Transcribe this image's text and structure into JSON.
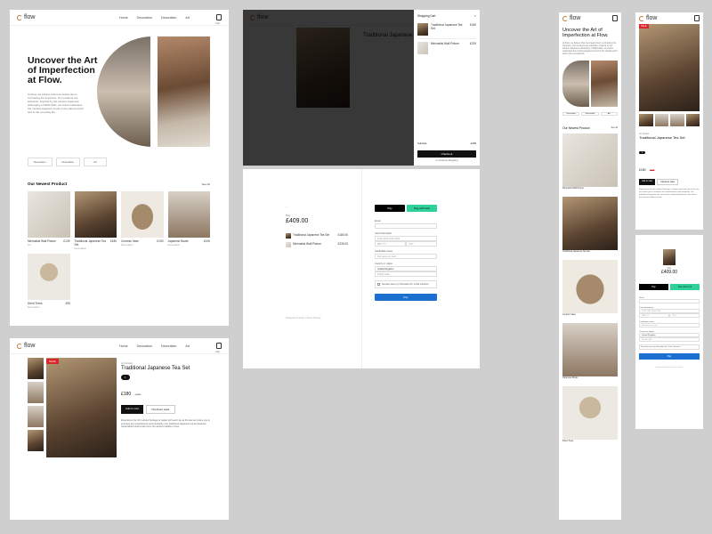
{
  "brand": {
    "name": "flow"
  },
  "nav": {
    "links": [
      "Home",
      "Decoration",
      "Decoration",
      "Art"
    ],
    "cart_label": "Cart"
  },
  "hero": {
    "title": "Uncover the Art of Imperfection at Flow.",
    "body": "At Flow, we believe that true beauty lies in embracing the imperfect. Our products are authentic, inspired by the ancient Japanese philosophy of Wabi-Sabi, our brand celebrates the modest elegance found in the natural world and in the everyday life.",
    "buttons": [
      "Decoration",
      "Decoration",
      "Art"
    ]
  },
  "newest": {
    "heading": "Our Newest Product",
    "see_all": "See All",
    "products": [
      {
        "name": "Minimalist Wall Picture",
        "sub": "Art",
        "price": "£139"
      },
      {
        "name": "Traditional Japanese Tea Set",
        "sub": "Decoration",
        "price": "£180"
      },
      {
        "name": "Ceramic Vase",
        "sub": "Decoration",
        "price": "£190"
      },
      {
        "name": "Japanese Bowls",
        "sub": "Decoration",
        "price": "£190"
      },
      {
        "name": "Dried Trees",
        "sub": "Decoration",
        "price": "£90"
      }
    ]
  },
  "product_page": {
    "badge": "SALE",
    "category": "Art Details",
    "title": "Traditional Japanese Tea Set",
    "qty": "1",
    "price": "£180",
    "old_price": "£250",
    "add_button": "Add to Cart",
    "secondary_button": "Checkout Later",
    "description": "Experience the rich cultural heritage of Japan with each sip as the tea set invites you to embrace the imperfections and tranquility. Our traditional Japanese tea set features handcrafted pieces that honor the ancient tradition of tea."
  },
  "cart_panel": {
    "title": "Shopping Cart",
    "items": [
      {
        "name": "Traditional Japanese Tea Set",
        "price": "£180"
      },
      {
        "name": "Minimalist Wall Picture",
        "price": "£239"
      }
    ],
    "subtotal_label": "Subtotal",
    "subtotal": "£409",
    "checkout_button": "Checkout",
    "continue": "or Continue Shopping"
  },
  "checkout": {
    "pay_label": "Pay",
    "total": "£409.00",
    "lines": [
      {
        "name": "Traditional Japanese Tea Set",
        "price": "£180.00"
      },
      {
        "name": "Minimalist Wall Picture",
        "price": "£239.00"
      }
    ],
    "apple_pay": "Pay",
    "link_button": "Pay with Link",
    "email_label": "Email",
    "card_label": "Card information",
    "card_placeholder": "1234 1234 1234 1234",
    "expiry_placeholder": "MM / YY",
    "cvc_placeholder": "CVC",
    "name_label": "Cardholder name",
    "name_placeholder": "Full name on card",
    "country_label": "Country or region",
    "country_value": "United Kingdom",
    "postcode_placeholder": "Postal code",
    "save_info": "Securely save my information for 1-click checkout",
    "pay_button": "Pay",
    "footer": "Powered by Stripe | Terms Privacy"
  },
  "colors": {
    "accent": "#c07a3c",
    "sale": "#d8262a",
    "pay_blue": "#1a6fd1",
    "link_green": "#2ed19a"
  }
}
